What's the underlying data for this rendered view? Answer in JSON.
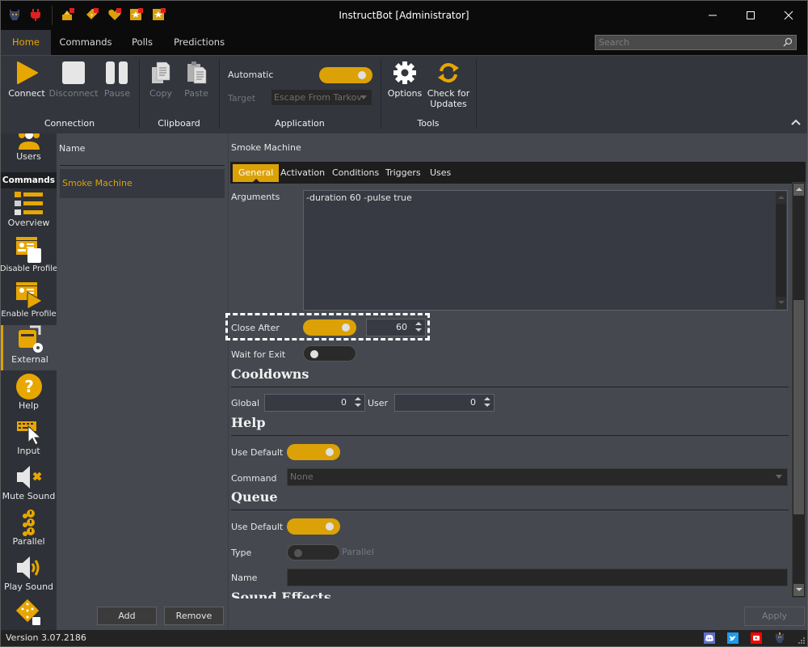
{
  "window": {
    "title": "InstructBot [Administrator]",
    "titlebar_icons": [
      "bot-logo-icon",
      "plug-icon",
      "gift-icon",
      "tag-icon",
      "heart-icon",
      "star-badge-icon",
      "star-icon"
    ],
    "controls": {
      "minimize": "minimize-icon",
      "maximize": "maximize-icon",
      "close": "close-icon"
    }
  },
  "menu": {
    "tabs": [
      {
        "label": "Home",
        "active": true
      },
      {
        "label": "Commands",
        "active": false
      },
      {
        "label": "Polls",
        "active": false
      },
      {
        "label": "Predictions",
        "active": false
      }
    ],
    "search_placeholder": "Search"
  },
  "ribbon": {
    "connection": {
      "group_label": "Connection",
      "connect": "Connect",
      "disconnect": "Disconnect",
      "pause": "Pause"
    },
    "clipboard": {
      "group_label": "Clipboard",
      "copy": "Copy",
      "paste": "Paste"
    },
    "application": {
      "group_label": "Application",
      "automatic_label": "Automatic",
      "automatic_on": true,
      "target_label": "Target",
      "target_value": "Escape From Tarkov"
    },
    "tools": {
      "group_label": "Tools",
      "options": "Options",
      "check_updates": "Check for Updates"
    }
  },
  "leftnav": {
    "items": [
      {
        "label": "Users",
        "icon": "users-icon"
      },
      {
        "label": "Overview",
        "icon": "overview-icon"
      },
      {
        "label": "Disable Profile",
        "icon": "disable-profile-icon"
      },
      {
        "label": "Enable Profile",
        "icon": "enable-profile-icon"
      },
      {
        "label": "External",
        "icon": "external-icon",
        "active": true
      },
      {
        "label": "Help",
        "icon": "help-icon"
      },
      {
        "label": "Input",
        "icon": "input-icon"
      },
      {
        "label": "Mute Sound",
        "icon": "mute-sound-icon"
      },
      {
        "label": "Parallel",
        "icon": "parallel-icon"
      },
      {
        "label": "Play Sound",
        "icon": "play-sound-icon"
      },
      {
        "label": "",
        "icon": "dice-icon"
      }
    ],
    "section_header": "Commands"
  },
  "list": {
    "column_header": "Name",
    "rows": [
      "Smoke Machine"
    ],
    "add_label": "Add",
    "remove_label": "Remove"
  },
  "detail": {
    "title": "Smoke Machine",
    "tabs": [
      {
        "label": "General",
        "active": true
      },
      {
        "label": "Activation",
        "active": false
      },
      {
        "label": "Conditions",
        "active": false
      },
      {
        "label": "Triggers",
        "active": false
      },
      {
        "label": "Uses",
        "active": false
      }
    ],
    "arguments_label": "Arguments",
    "arguments_value": "-duration 60 -pulse true",
    "close_after_label": "Close After",
    "close_after_on": true,
    "close_after_value": "60",
    "wait_for_exit_label": "Wait for Exit",
    "wait_for_exit_on": false,
    "cooldowns": {
      "heading": "Cooldowns",
      "global_label": "Global",
      "global_value": "0",
      "user_label": "User",
      "user_value": "0"
    },
    "help": {
      "heading": "Help",
      "use_default_label": "Use Default",
      "use_default_on": true,
      "command_label": "Command",
      "command_value": "None"
    },
    "queue": {
      "heading": "Queue",
      "use_default_label": "Use Default",
      "use_default_on": true,
      "type_label": "Type",
      "type_value": "Parallel",
      "type_on": false,
      "name_label": "Name",
      "name_value": ""
    },
    "sound_effects_heading": "Sound Effects",
    "apply_label": "Apply"
  },
  "status": {
    "version": "Version 3.07.2186",
    "social": [
      "discord-icon",
      "twitter-icon",
      "youtube-icon",
      "bot-logo-icon"
    ]
  },
  "colors": {
    "accent": "#dba107",
    "background": "#45484f",
    "titlebar": "#0b0b0b"
  }
}
